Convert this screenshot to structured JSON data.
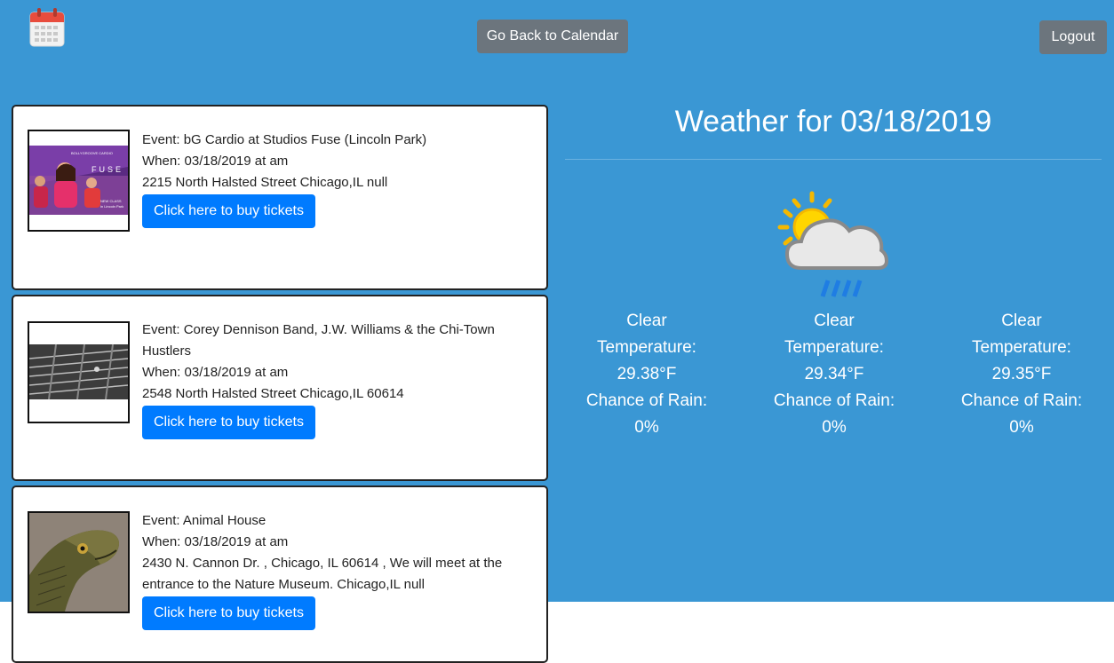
{
  "header": {
    "logo_icon": "calendar-icon",
    "back_label": "Go Back to Calendar",
    "logout_label": "Logout"
  },
  "events": [
    {
      "image_icon": "bollygroove-cardio-photo",
      "image_text": [
        "BOLLYGROOVE CARDIO",
        "FUSE",
        "NEW CLASS",
        "in Lincoln Park"
      ],
      "title": "Event: bG Cardio at Studios Fuse (Lincoln Park)",
      "when": "When: 03/18/2019 at am",
      "address": "2215 North Halsted Street Chicago,IL null",
      "button_label": "Click here to buy tickets"
    },
    {
      "image_icon": "guitar-strings-photo",
      "title": "Event: Corey Dennison Band, J.W. Williams & the Chi-Town Hustlers",
      "when": "When: 03/18/2019 at am",
      "address": "2548 North Halsted Street Chicago,IL 60614",
      "button_label": "Click here to buy tickets"
    },
    {
      "image_icon": "lizard-photo",
      "title": "Event: Animal House",
      "when": "When: 03/18/2019 at am",
      "address": "2430 N. Cannon Dr. , Chicago, IL 60614 , We will meet at the entrance to the Nature Museum. Chicago,IL null",
      "button_label": "Click here to buy tickets"
    }
  ],
  "weather": {
    "title": "Weather for 03/18/2019",
    "icon": "sun-cloud-rain-icon",
    "forecasts": [
      {
        "condition": "Clear",
        "temp_label": "Temperature:",
        "temp": "29.38°F",
        "rain_label": "Chance of Rain:",
        "rain": "0%"
      },
      {
        "condition": "Clear",
        "temp_label": "Temperature:",
        "temp": "29.34°F",
        "rain_label": "Chance of Rain:",
        "rain": "0%"
      },
      {
        "condition": "Clear",
        "temp_label": "Temperature:",
        "temp": "29.35°F",
        "rain_label": "Chance of Rain:",
        "rain": "0%"
      }
    ]
  },
  "colors": {
    "background": "#3a97d4",
    "button_primary": "#007bff",
    "button_secondary": "#6c757d"
  }
}
